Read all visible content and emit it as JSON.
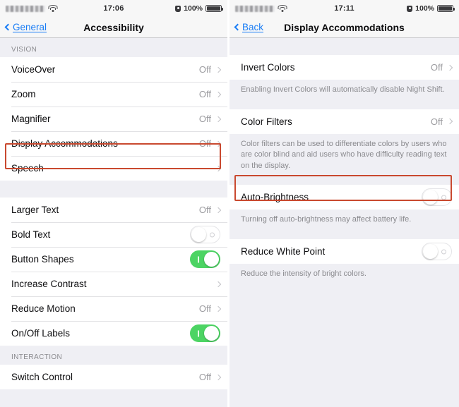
{
  "left": {
    "status": {
      "time": "17:06",
      "battery_pct": "100%",
      "carrier": "",
      "wifi_icon": "wifi-icon",
      "lock_icon": "lock-icon",
      "battery_icon": "battery-icon"
    },
    "nav": {
      "back_label": "General",
      "title": "Accessibility",
      "back_icon": "chevron-left-icon"
    },
    "sections": [
      {
        "header": "VISION",
        "rows": [
          {
            "label": "VoiceOver",
            "value": "Off",
            "accessory": "chevron"
          },
          {
            "label": "Zoom",
            "value": "Off",
            "accessory": "chevron"
          },
          {
            "label": "Magnifier",
            "value": "Off",
            "accessory": "chevron"
          },
          {
            "label": "Display Accommodations",
            "value": "Off",
            "accessory": "chevron",
            "highlight": true
          },
          {
            "label": "Speech",
            "value": "",
            "accessory": "chevron"
          }
        ]
      },
      {
        "header": "",
        "rows": [
          {
            "label": "Larger Text",
            "value": "Off",
            "accessory": "chevron"
          },
          {
            "label": "Bold Text",
            "value": "",
            "accessory": "toggle",
            "toggle": "off"
          },
          {
            "label": "Button Shapes",
            "value": "",
            "accessory": "toggle",
            "toggle": "on"
          },
          {
            "label": "Increase Contrast",
            "value": "",
            "accessory": "chevron"
          },
          {
            "label": "Reduce Motion",
            "value": "Off",
            "accessory": "chevron"
          },
          {
            "label": "On/Off Labels",
            "value": "",
            "accessory": "toggle",
            "toggle": "on"
          }
        ]
      },
      {
        "header": "INTERACTION",
        "rows": [
          {
            "label": "Switch Control",
            "value": "Off",
            "accessory": "chevron"
          }
        ]
      }
    ]
  },
  "right": {
    "status": {
      "time": "17:11",
      "battery_pct": "100%",
      "carrier": "",
      "wifi_icon": "wifi-icon",
      "lock_icon": "lock-icon",
      "battery_icon": "battery-icon"
    },
    "nav": {
      "back_label": "Back",
      "title": "Display Accommodations",
      "back_icon": "chevron-left-icon"
    },
    "blocks": [
      {
        "rows": [
          {
            "label": "Invert Colors",
            "value": "Off",
            "accessory": "chevron"
          }
        ],
        "note": "Enabling Invert Colors will automatically disable Night Shift."
      },
      {
        "rows": [
          {
            "label": "Color Filters",
            "value": "Off",
            "accessory": "chevron"
          }
        ],
        "note": "Color filters can be used to differentiate colors by users who are color blind and aid users who have difficulty reading text on the display."
      },
      {
        "rows": [
          {
            "label": "Auto-Brightness",
            "value": "",
            "accessory": "toggle",
            "toggle": "off",
            "highlight": true
          }
        ],
        "note": "Turning off auto-brightness may affect battery life."
      },
      {
        "rows": [
          {
            "label": "Reduce White Point",
            "value": "",
            "accessory": "toggle",
            "toggle": "off"
          }
        ],
        "note": "Reduce the intensity of bright colors."
      }
    ]
  },
  "colors": {
    "highlight": "#c9492f",
    "toggle_on": "#4cd463",
    "link": "#1a7df5",
    "background": "#efeff4"
  }
}
